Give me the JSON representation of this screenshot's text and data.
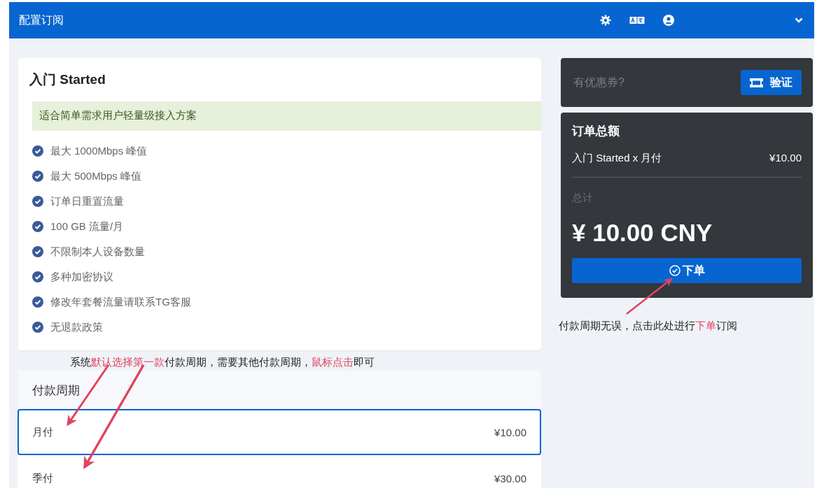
{
  "header": {
    "title": "配置订阅"
  },
  "plan": {
    "name": "入门 Started",
    "description": "适合简单需求用户轻量级接入方案",
    "features": [
      "最大 1000Mbps 峰值",
      "最大 500Mbps 峰值",
      "订单日重置流量",
      "100 GB 流量/月",
      "不限制本人设备数量",
      "多种加密协议",
      "修改年套餐流量请联系TG客服",
      "无退款政策"
    ]
  },
  "annotations": [
    {
      "segments": [
        {
          "text": "系统",
          "highlight": false
        },
        {
          "text": "默认选择第一款",
          "highlight": true
        },
        {
          "text": "付款周期，需要其他付款周期，",
          "highlight": false
        },
        {
          "text": "鼠标点击",
          "highlight": true
        },
        {
          "text": "即可",
          "highlight": false
        }
      ]
    },
    {
      "segments": [
        {
          "text": "付款周期无误，点击此处进行",
          "highlight": false
        },
        {
          "text": "下单",
          "highlight": true
        },
        {
          "text": "订阅",
          "highlight": false
        }
      ]
    }
  ],
  "payment": {
    "title": "付款周期",
    "options": [
      {
        "label": "月付",
        "price": "¥10.00",
        "selected": true
      },
      {
        "label": "季付",
        "price": "¥30.00",
        "selected": false
      }
    ]
  },
  "coupon": {
    "placeholder": "有优惠券?",
    "button": "验证"
  },
  "order": {
    "title": "订单总额",
    "line_item": "入门 Started x 月付",
    "line_price": "¥10.00",
    "total_label": "总计",
    "total": "¥ 10.00 CNY",
    "submit": "下单"
  }
}
